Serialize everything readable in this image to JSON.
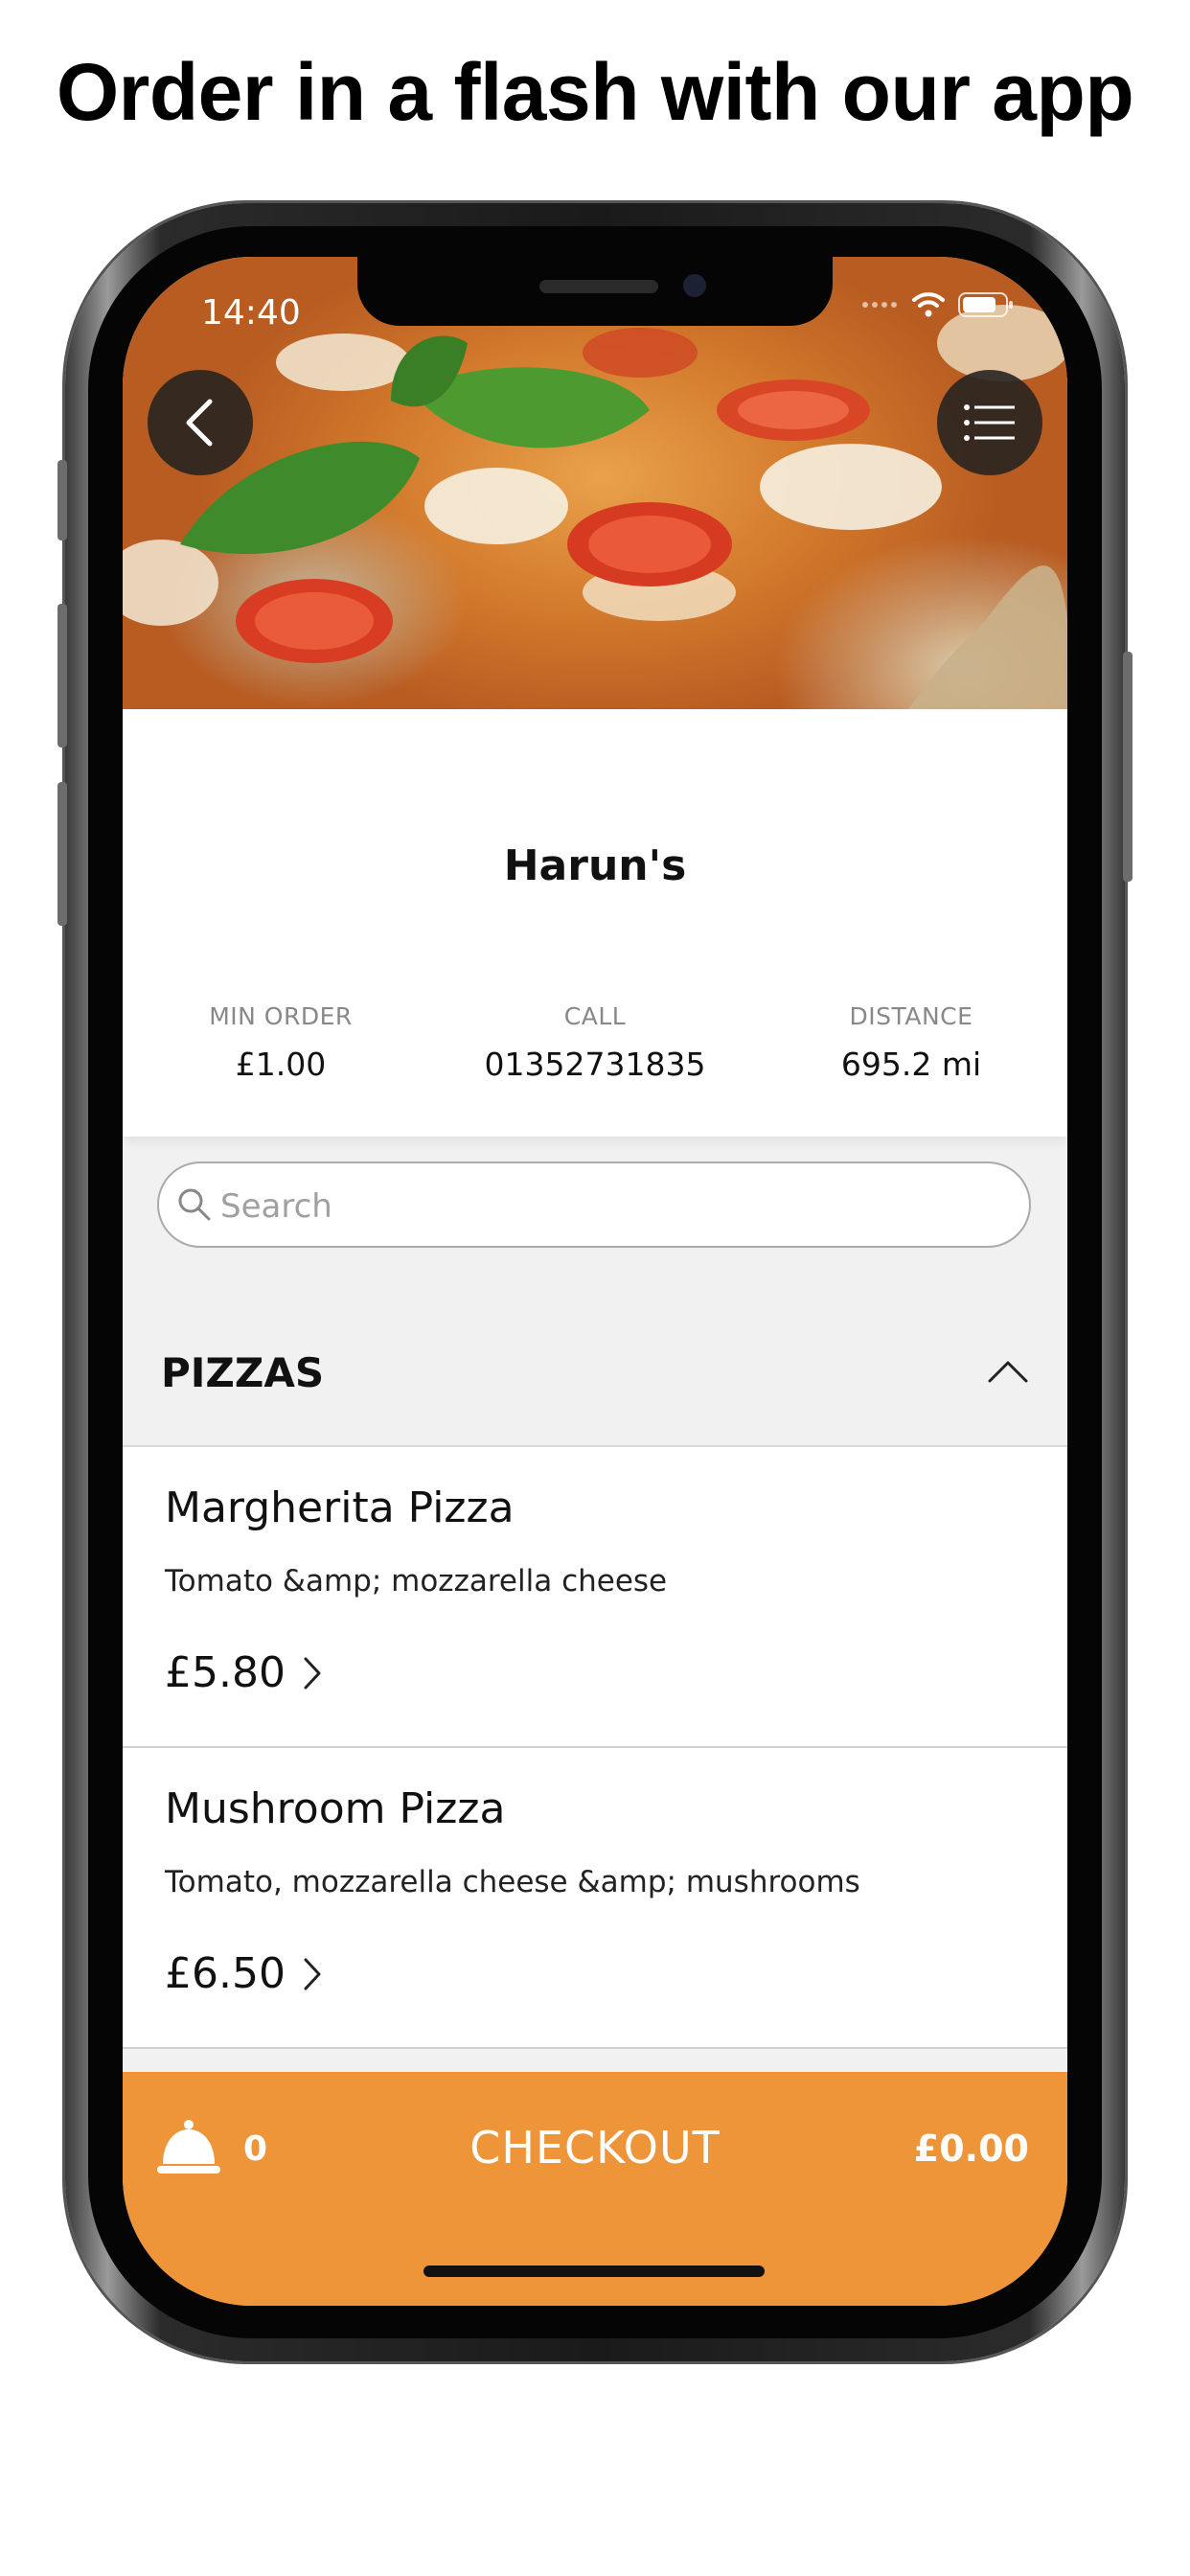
{
  "headline": "Order in a flash with our app",
  "status_bar": {
    "time": "14:40"
  },
  "restaurant": {
    "name": "Harun's",
    "stats": [
      {
        "label": "MIN ORDER",
        "value": "£1.00"
      },
      {
        "label": "CALL",
        "value": "01352731835"
      },
      {
        "label": "DISTANCE",
        "value": "695.2 mi"
      }
    ]
  },
  "search": {
    "placeholder": "Search",
    "value": ""
  },
  "category": {
    "title": "PIZZAS",
    "expanded": true
  },
  "items": [
    {
      "name": "Margherita Pizza",
      "description": "Tomato &amp; mozzarella cheese",
      "price": "£5.80"
    },
    {
      "name": "Mushroom Pizza",
      "description": "Tomato, mozzarella cheese &amp; mushrooms",
      "price": "£6.50"
    }
  ],
  "checkout": {
    "count": "0",
    "label": "CHECKOUT",
    "total": "£0.00"
  },
  "icons": {
    "back": "chevron-left-icon",
    "menu": "menu-icon",
    "search": "search-icon",
    "collapse": "chevron-up-icon",
    "item_arrow": "chevron-right-icon",
    "cart": "bell-icon"
  },
  "colors": {
    "accent": "#ee953a",
    "background": "#f1f1f1"
  }
}
